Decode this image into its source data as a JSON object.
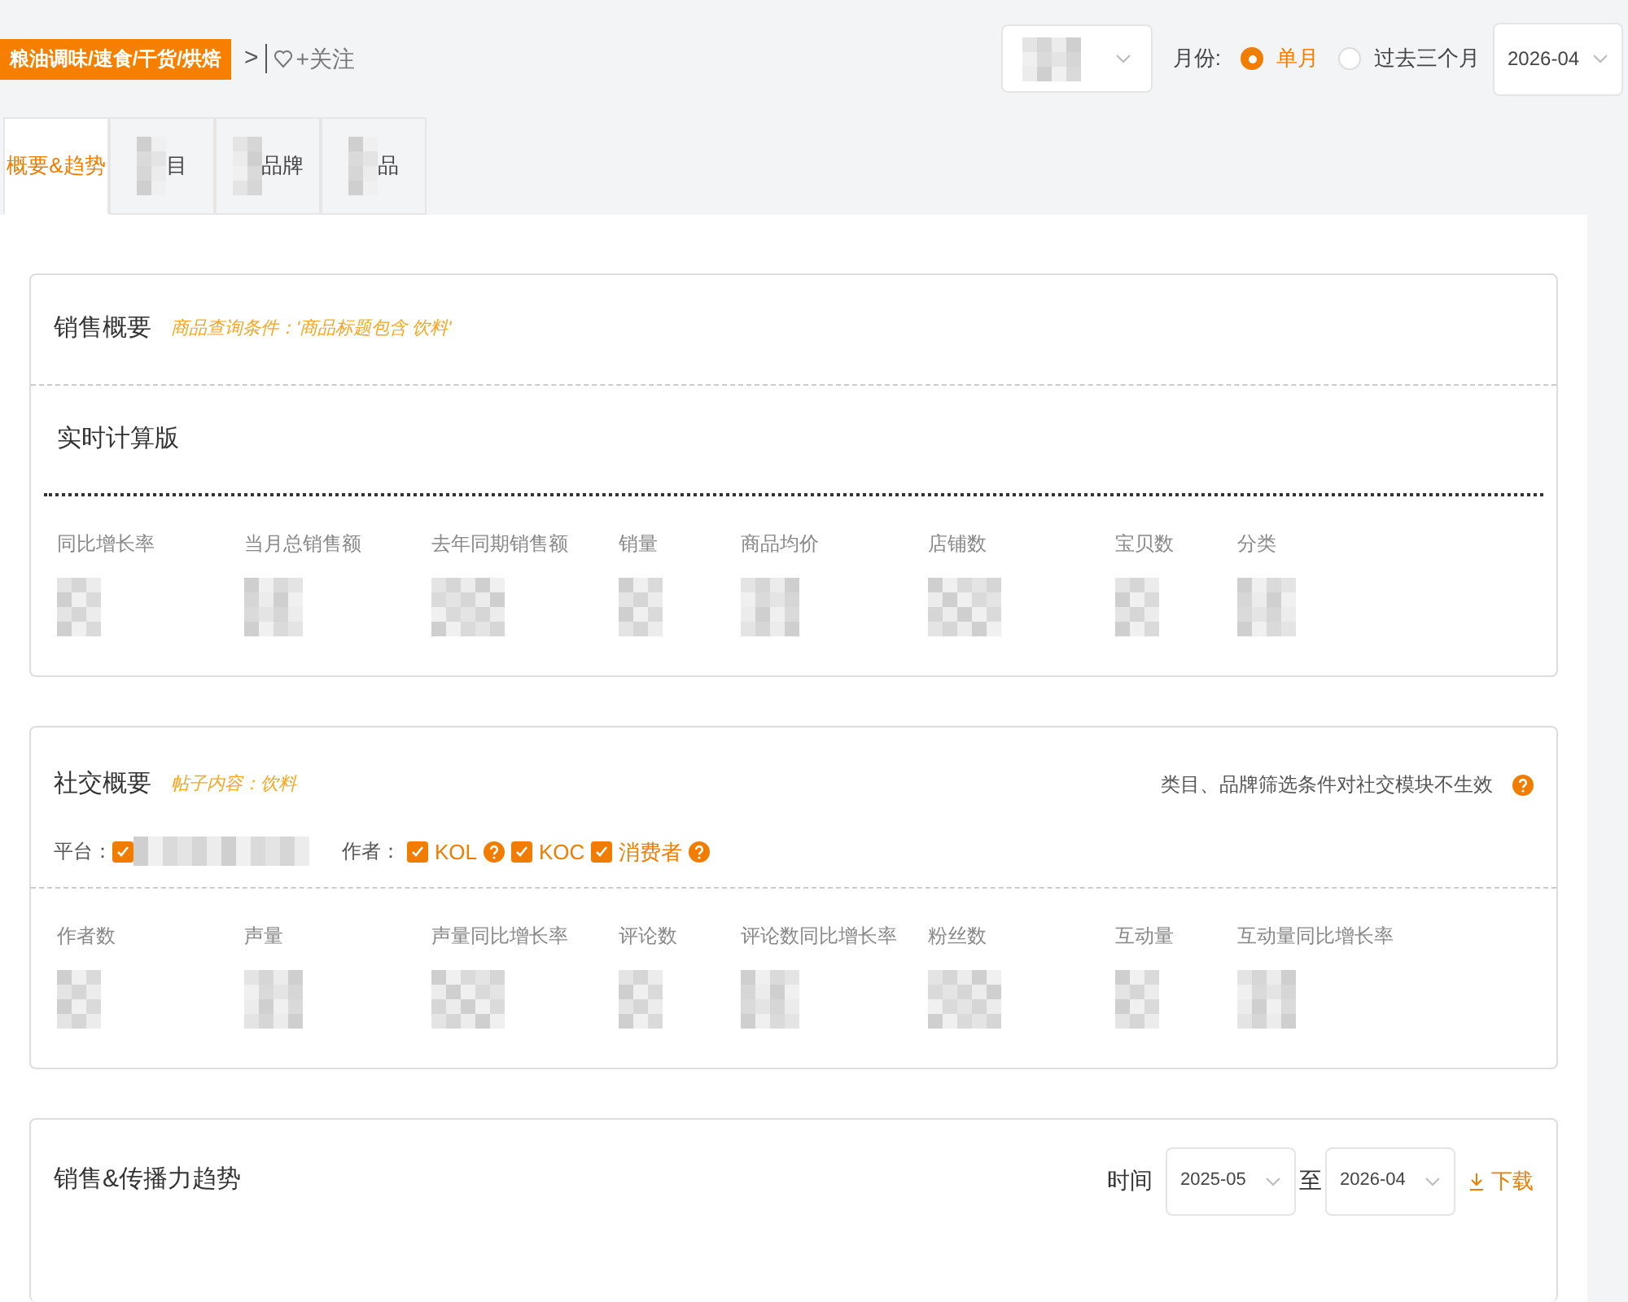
{
  "breadcrumb": {
    "category": "粮油调味/速食/干货/烘焙",
    "separator": ">",
    "follow": "+关注"
  },
  "filters": {
    "month_label": "月份:",
    "options": [
      {
        "label": "单月",
        "selected": true
      },
      {
        "label": "过去三个月",
        "selected": false
      }
    ],
    "month": "2026-04"
  },
  "tabs": [
    {
      "label": "概要&趋势",
      "selected": true,
      "blurred": false
    },
    {
      "label": "目",
      "selected": false,
      "blurred": true
    },
    {
      "label": "品牌",
      "selected": false,
      "blurred": true
    },
    {
      "label": "品",
      "selected": false,
      "blurred": true
    }
  ],
  "sales": {
    "title": "销售概要",
    "condition": "商品查询条件：'商品标题包含 饮料'",
    "subtitle": "实时计算版",
    "metrics": [
      "同比增长率",
      "当月总销售额",
      "去年同期销售额",
      "销量",
      "商品均价",
      "店铺数",
      "宝贝数",
      "分类"
    ]
  },
  "social": {
    "title": "社交概要",
    "condition": "帖子内容：饮料",
    "note": "类目、品牌筛选条件对社交模块不生效",
    "platform_label": "平台：",
    "platform": {
      "checked": true
    },
    "author_label": "作者：",
    "authors": [
      {
        "label": "KOL",
        "checked": true,
        "help": true
      },
      {
        "label": "KOC",
        "checked": true,
        "help": false
      },
      {
        "label": "消费者",
        "checked": true,
        "help": true
      }
    ],
    "metrics": [
      "作者数",
      "声量",
      "声量同比增长率",
      "评论数",
      "评论数同比增长率",
      "粉丝数",
      "互动量",
      "互动量同比增长率"
    ]
  },
  "trend": {
    "title": "销售&传播力趋势",
    "time_label": "时间",
    "from": "2025-05",
    "to_label": "至",
    "to": "2026-04",
    "download": "下载"
  }
}
